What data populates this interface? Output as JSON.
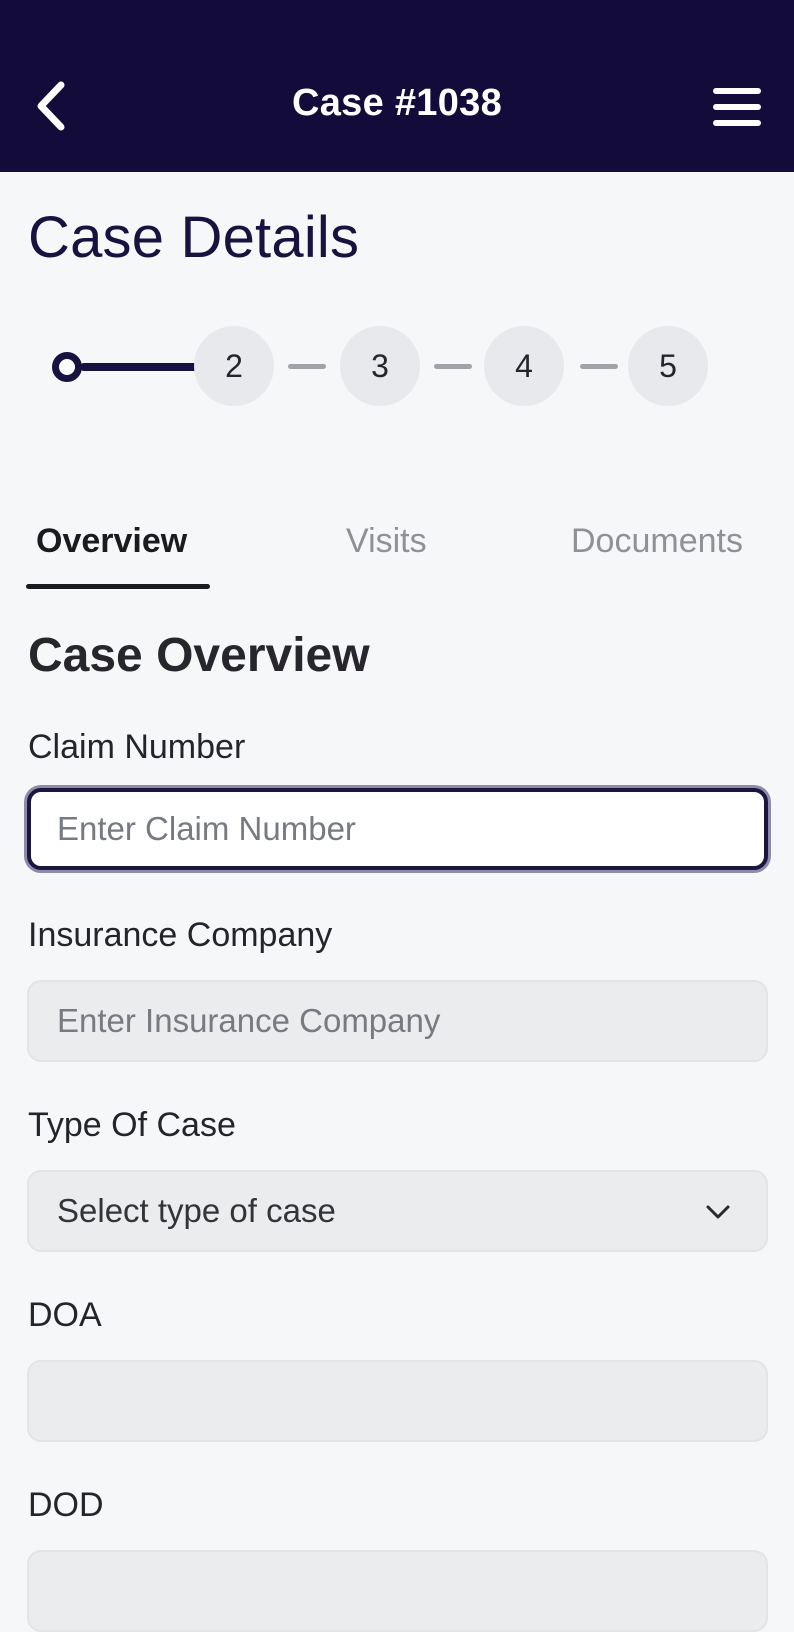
{
  "header": {
    "title": "Case #1038",
    "back_icon": "chevron-left-icon",
    "menu_icon": "hamburger-menu-icon"
  },
  "page": {
    "title": "Case Details"
  },
  "stepper": {
    "current_step": 1,
    "steps": [
      "2",
      "3",
      "4",
      "5"
    ]
  },
  "tabs": {
    "items": [
      "Overview",
      "Visits",
      "Documents"
    ],
    "active": "Overview"
  },
  "form": {
    "section_title": "Case Overview",
    "claim_number": {
      "label": "Claim Number",
      "placeholder": "Enter Claim Number"
    },
    "insurance_company": {
      "label": "Insurance Company",
      "placeholder": "Enter Insurance Company"
    },
    "type_of_case": {
      "label": "Type Of Case",
      "selected": "Select type of case",
      "icon": "chevron-down-icon"
    },
    "doa": {
      "label": "DOA",
      "value": ""
    },
    "dod": {
      "label": "DOD",
      "value": ""
    }
  },
  "colors": {
    "header_bg": "#130c3b",
    "title_text": "#17123f",
    "page_bg": "#f6f7f9",
    "field_bg": "#ebeced"
  }
}
